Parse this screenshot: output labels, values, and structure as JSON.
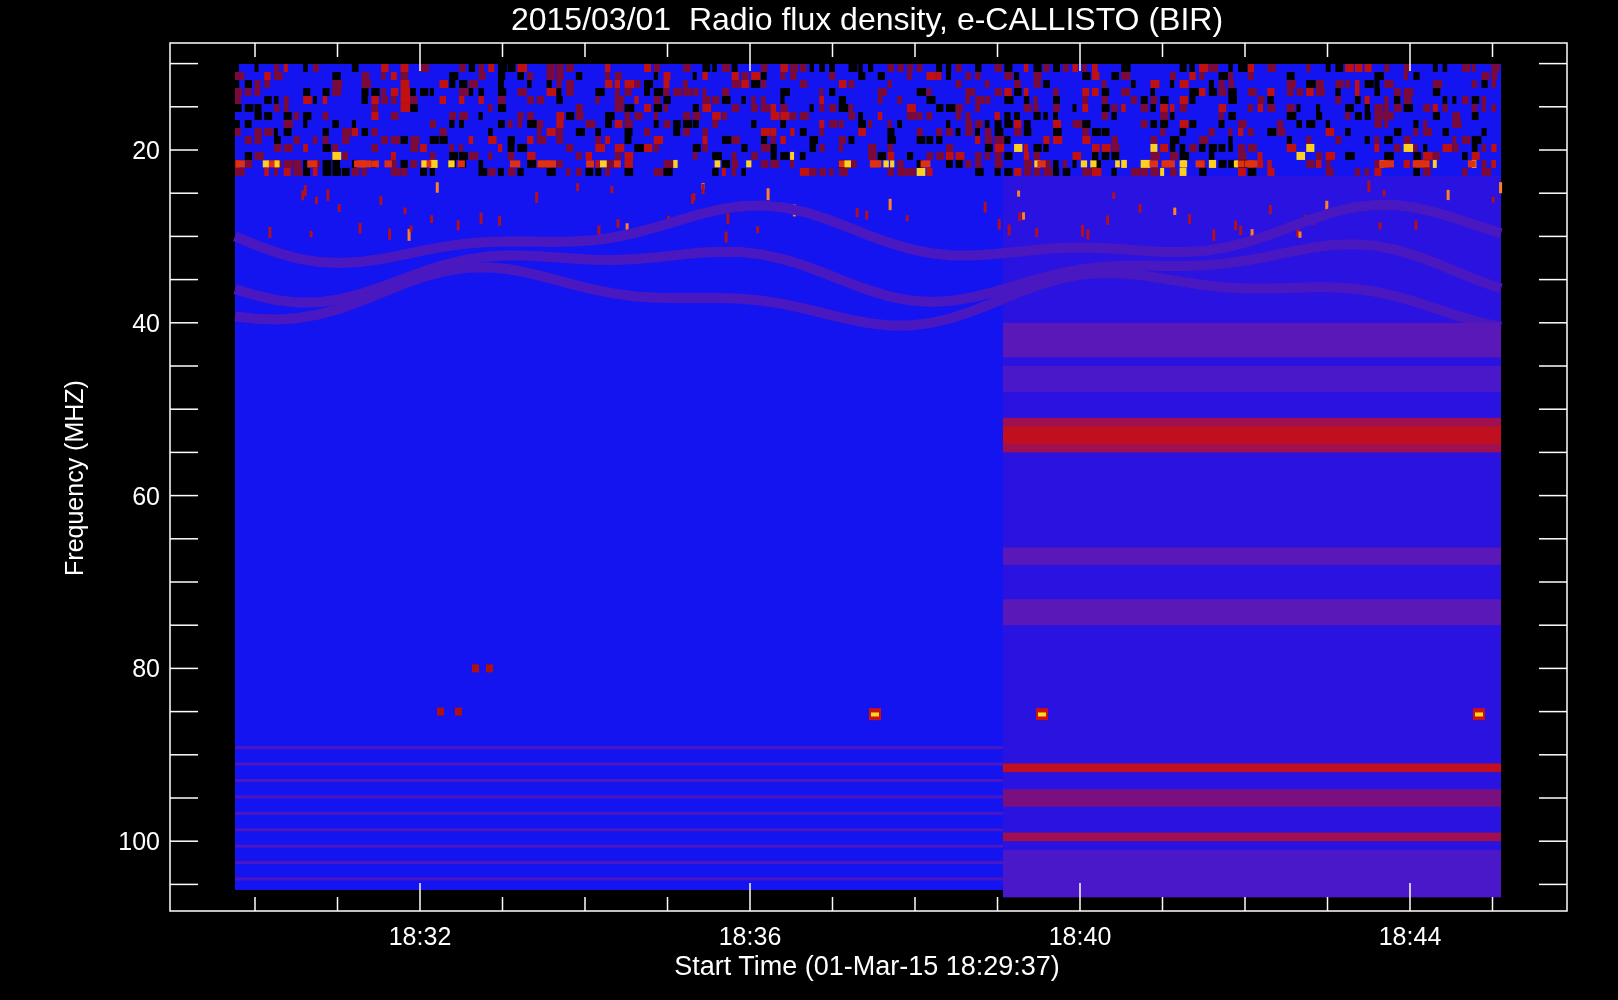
{
  "title": "2015/03/01  Radio flux density, e-CALLISTO (BIR)",
  "y_axis": {
    "label": "Frequency (MHZ)",
    "ticks": [
      "20",
      "40",
      "60",
      "80",
      "100"
    ]
  },
  "x_axis": {
    "label": "Start Time (01-Mar-15 18:29:37)",
    "ticks": [
      "18:32",
      "18:36",
      "18:40",
      "18:44"
    ]
  }
}
